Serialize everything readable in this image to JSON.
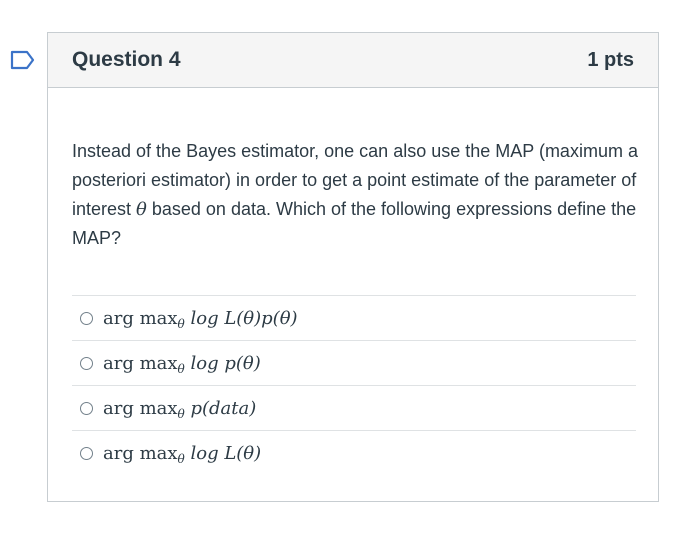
{
  "question": {
    "title": "Question 4",
    "points": "1 pts",
    "text_before": "Instead of the Bayes estimator, one can also use the MAP (maximum a posteriori estimator) in order to get a point estimate of the parameter of interest ",
    "symbol": "θ",
    "text_after": " based on data. Which of the following expressions define the MAP?"
  },
  "flag": {
    "icon": "bookmark-flag-icon",
    "color": "#3b73c8"
  },
  "answers": [
    {
      "fn_arg": "arg max",
      "sub": "θ",
      "rest": " log L(θ)p(θ)"
    },
    {
      "fn_arg": "arg max",
      "sub": "θ",
      "rest": " log p(θ)"
    },
    {
      "fn_arg": "arg max",
      "sub": "θ",
      "rest": " p(data)"
    },
    {
      "fn_arg": "arg max",
      "sub": "θ",
      "rest": " log L(θ)"
    }
  ],
  "colors": {
    "header_bg": "#f5f5f5",
    "border": "#c7cdd1",
    "text": "#2d3b45"
  }
}
